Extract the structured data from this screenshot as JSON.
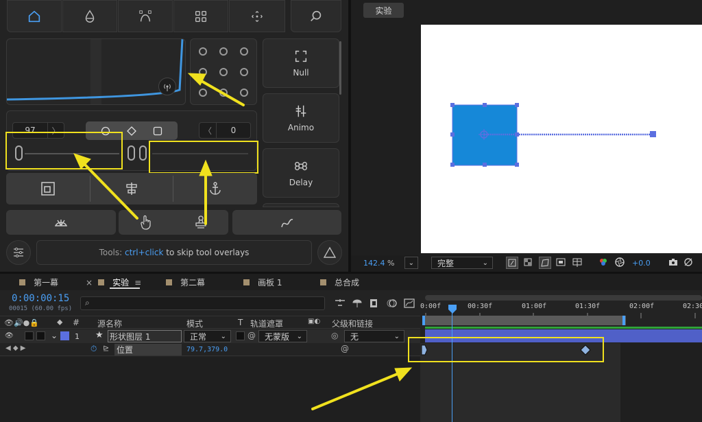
{
  "plugin": {
    "top_tools": [
      "home-icon",
      "drop-icon",
      "bezier-icon",
      "grid-icon",
      "anchor-target-icon",
      "search-icon"
    ],
    "side_buttons": [
      {
        "label": "Null",
        "icon": "null-corners-icon"
      },
      {
        "label": "Animo",
        "icon": "sliders-icon"
      },
      {
        "label": "Delay",
        "icon": "command-icon"
      }
    ],
    "left_value": "97",
    "right_value": "0",
    "slider_left_label": "0",
    "slider_mid_label": "0 0",
    "tip": {
      "prefix": "Tools:",
      "shortcut": "ctrl+click",
      "suffix": "to skip tool overlays"
    }
  },
  "comp": {
    "title": "实验",
    "zoom": "142.4",
    "zoom_unit": "%",
    "quality": "完整",
    "exposure": "+0.0"
  },
  "timeline": {
    "tabs": [
      "第一幕",
      "实验",
      "第二幕",
      "画板 1",
      "总合成"
    ],
    "timecode": "0:00:00:15",
    "fps_note": "00015 (60.00 fps)",
    "search_placeholder": "",
    "headers": {
      "hash": "#",
      "source": "源名称",
      "mode": "模式",
      "t": "T",
      "track_matte": "轨道遮罩",
      "parent": "父级和链接"
    },
    "layer": {
      "index": "1",
      "name": "形状图层 1",
      "mode": "正常",
      "matte": "无蒙版",
      "parent": "无"
    },
    "property": {
      "name": "位置",
      "value": "79.7,379.0"
    },
    "ruler": [
      "0:00f",
      "00:30f",
      "01:00f",
      "01:30f",
      "02:00f",
      "02:30"
    ]
  },
  "colors": {
    "accent": "#4a9ff5",
    "highlight": "#f0e11e",
    "layer": "#5b6fe0",
    "shape_fill": "#1688d8"
  }
}
